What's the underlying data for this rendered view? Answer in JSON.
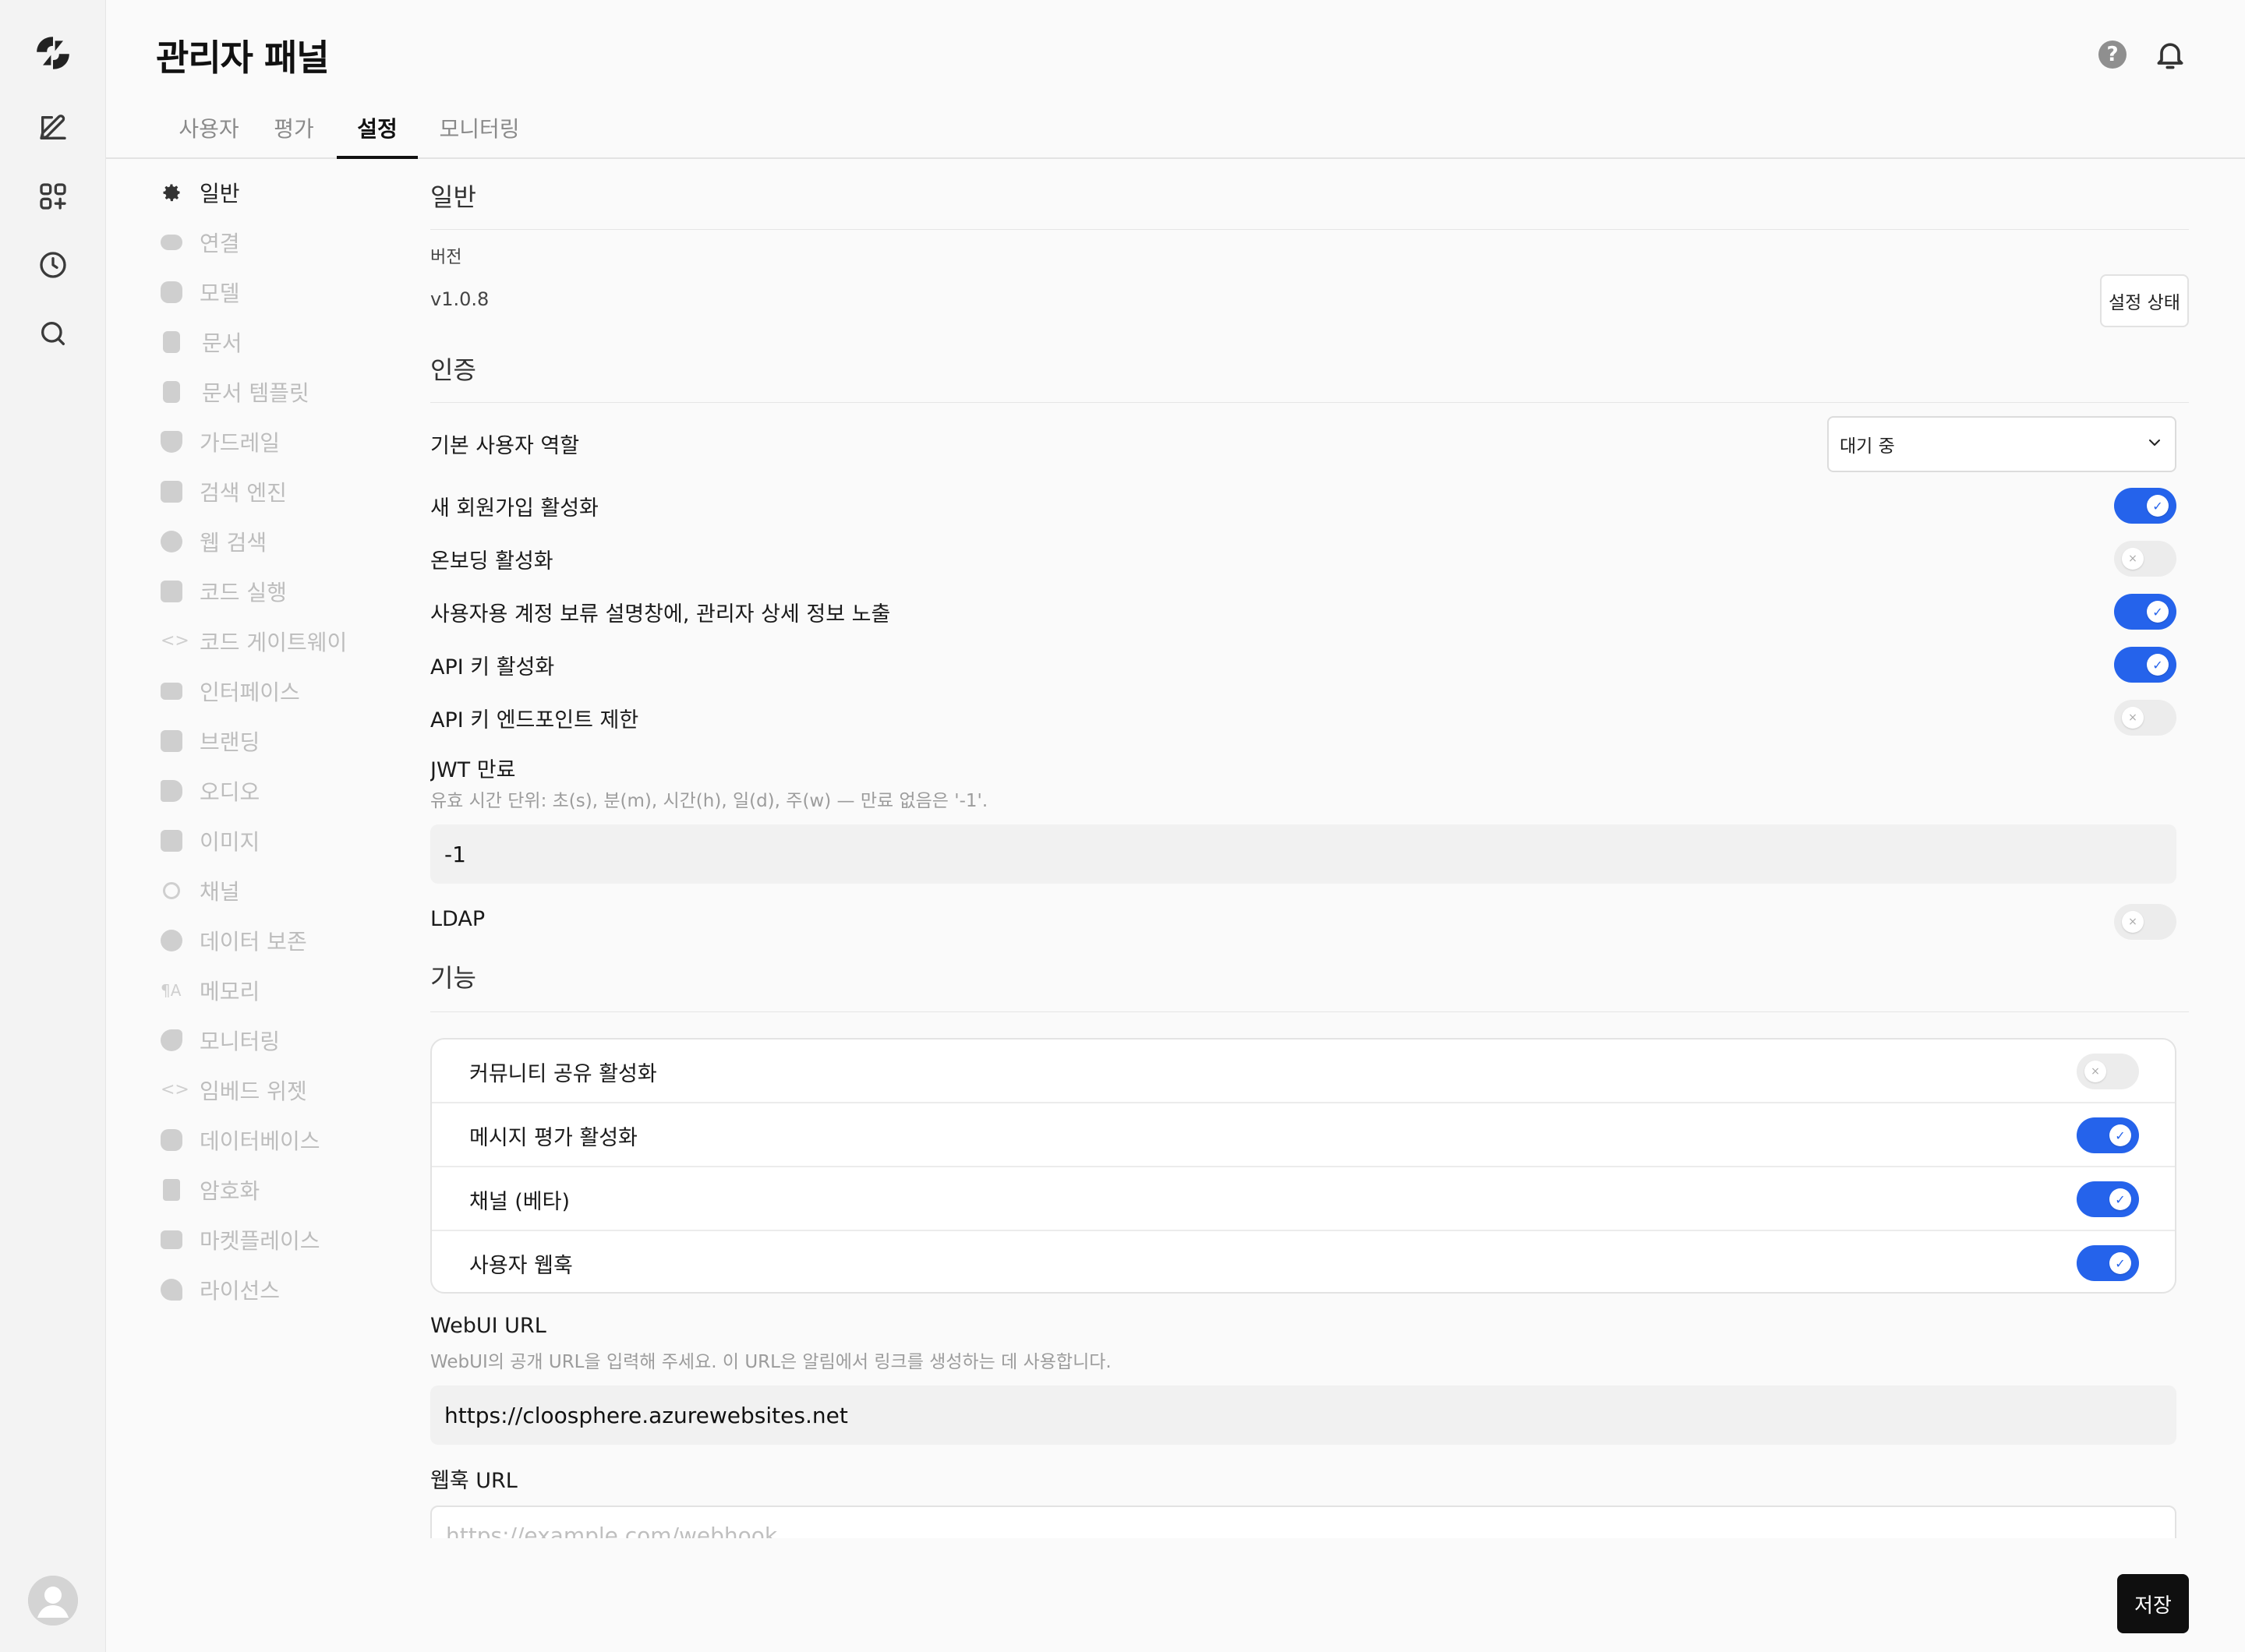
{
  "header": {
    "title": "관리자 패널",
    "help_icon_text": "?"
  },
  "tabs": [
    {
      "label": "사용자"
    },
    {
      "label": "평가"
    },
    {
      "label": "설정",
      "active": true
    },
    {
      "label": "모니터링"
    }
  ],
  "settings_nav": [
    {
      "label": "일반",
      "icon": "gear-icon",
      "active": true
    },
    {
      "label": "연결",
      "icon": "cloud-icon"
    },
    {
      "label": "모델",
      "icon": "database-icon"
    },
    {
      "label": "문서",
      "icon": "document-icon"
    },
    {
      "label": "문서 템플릿",
      "icon": "document-template-icon"
    },
    {
      "label": "가드레일",
      "icon": "shield-icon"
    },
    {
      "label": "검색 엔진",
      "icon": "grid-icon"
    },
    {
      "label": "웹 검색",
      "icon": "globe-icon"
    },
    {
      "label": "코드 실행",
      "icon": "terminal-icon"
    },
    {
      "label": "코드 게이트웨이",
      "icon": "code-icon"
    },
    {
      "label": "인터페이스",
      "icon": "monitor-icon"
    },
    {
      "label": "브랜딩",
      "icon": "edit-icon"
    },
    {
      "label": "오디오",
      "icon": "speaker-icon"
    },
    {
      "label": "이미지",
      "icon": "image-icon"
    },
    {
      "label": "채널",
      "icon": "link-icon"
    },
    {
      "label": "데이터 보존",
      "icon": "clock-icon"
    },
    {
      "label": "메모리",
      "icon": "memory-icon"
    },
    {
      "label": "모니터링",
      "icon": "monitoring-icon"
    },
    {
      "label": "임베드 위젯",
      "icon": "embed-icon"
    },
    {
      "label": "데이터베이스",
      "icon": "database-icon"
    },
    {
      "label": "암호화",
      "icon": "lock-icon"
    },
    {
      "label": "마켓플레이스",
      "icon": "archive-icon"
    },
    {
      "label": "라이선스",
      "icon": "key-icon"
    }
  ],
  "general": {
    "section_title": "일반",
    "version_label": "버전",
    "version_value": "v1.0.8",
    "status_button": "설정 상태"
  },
  "auth": {
    "section_title": "인증",
    "default_role_label": "기본 사용자 역할",
    "default_role_value": "대기 중",
    "signup_label": "새 회원가입 활성화",
    "signup_on": true,
    "onboarding_label": "온보딩 활성화",
    "onboarding_on": false,
    "pending_details_label": "사용자용 계정 보류 설명창에, 관리자 상세 정보 노출",
    "pending_details_on": true,
    "api_key_label": "API 키 활성화",
    "api_key_on": true,
    "api_endpoint_label": "API 키 엔드포인트 제한",
    "api_endpoint_on": false,
    "jwt_label": "JWT 만료",
    "jwt_hint": "유효 시간 단위: 초(s), 분(m), 시간(h), 일(d), 주(w) — 만료 없음은 '-1'.",
    "jwt_value": "-1",
    "ldap_label": "LDAP",
    "ldap_on": false
  },
  "features": {
    "section_title": "기능",
    "items": [
      {
        "label": "커뮤니티 공유 활성화",
        "on": false
      },
      {
        "label": "메시지 평가 활성화",
        "on": true
      },
      {
        "label": "채널 (베타)",
        "on": true
      },
      {
        "label": "사용자 웹훅",
        "on": true
      }
    ]
  },
  "webui": {
    "url_label": "WebUI URL",
    "url_hint": "WebUI의 공개 URL을 입력해 주세요. 이 URL은 알림에서 링크를 생성하는 데 사용합니다.",
    "url_value": "https://cloosphere.azurewebsites.net",
    "webhook_label": "웹훅 URL",
    "webhook_placeholder": "https://example.com/webhook"
  },
  "footer": {
    "save_label": "저장"
  },
  "colors": {
    "accent": "#2563eb",
    "toggle_off": "#ececec",
    "save_button": "#0f0f0f"
  }
}
